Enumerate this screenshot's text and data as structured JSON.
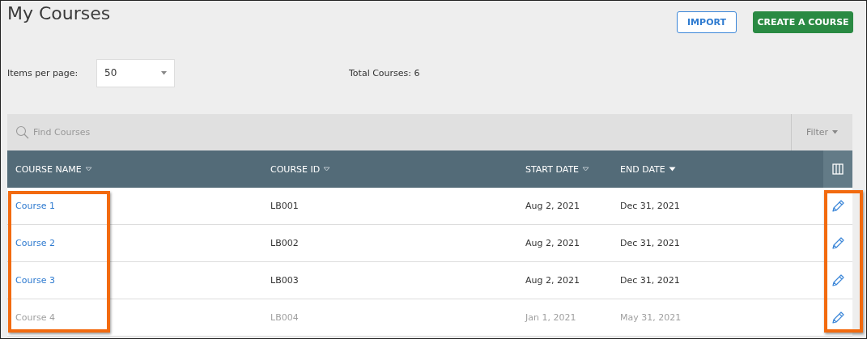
{
  "page_title": "My Courses",
  "buttons": [
    {
      "kind": "outline",
      "label": "IMPORT"
    },
    {
      "kind": "primary",
      "label": "CREATE A COURSE"
    }
  ],
  "items_per_page": {
    "label": "Items per page:",
    "value": "50"
  },
  "total": "Total Courses: 6",
  "search": {
    "placeholder": "Find Courses"
  },
  "filter": {
    "label": "Filter"
  },
  "table": {
    "columns": [
      {
        "label": "COURSE NAME",
        "sorted": false,
        "highlighted": true
      },
      {
        "label": "COURSE ID",
        "sorted": false,
        "highlighted": false
      },
      {
        "label": "START DATE",
        "sorted": false,
        "highlighted": false
      },
      {
        "label": "END DATE",
        "sorted": true,
        "highlighted": false
      }
    ],
    "edit_column": {
      "highlighted": true
    },
    "rows": [
      {
        "name": "Course 1",
        "id": "LB001",
        "start": "Aug 2, 2021",
        "end": "Dec 31, 2021",
        "disabled": false
      },
      {
        "name": "Course 2",
        "id": "LB002",
        "start": "Aug 2, 2021",
        "end": "Dec 31, 2021",
        "disabled": false
      },
      {
        "name": "Course 3",
        "id": "LB003",
        "start": "Aug 2, 2021",
        "end": "Dec 31, 2021",
        "disabled": false
      },
      {
        "name": "Course 4",
        "id": "LB004",
        "start": "Jan 1, 2021",
        "end": "May 31, 2021",
        "disabled": true
      }
    ]
  }
}
